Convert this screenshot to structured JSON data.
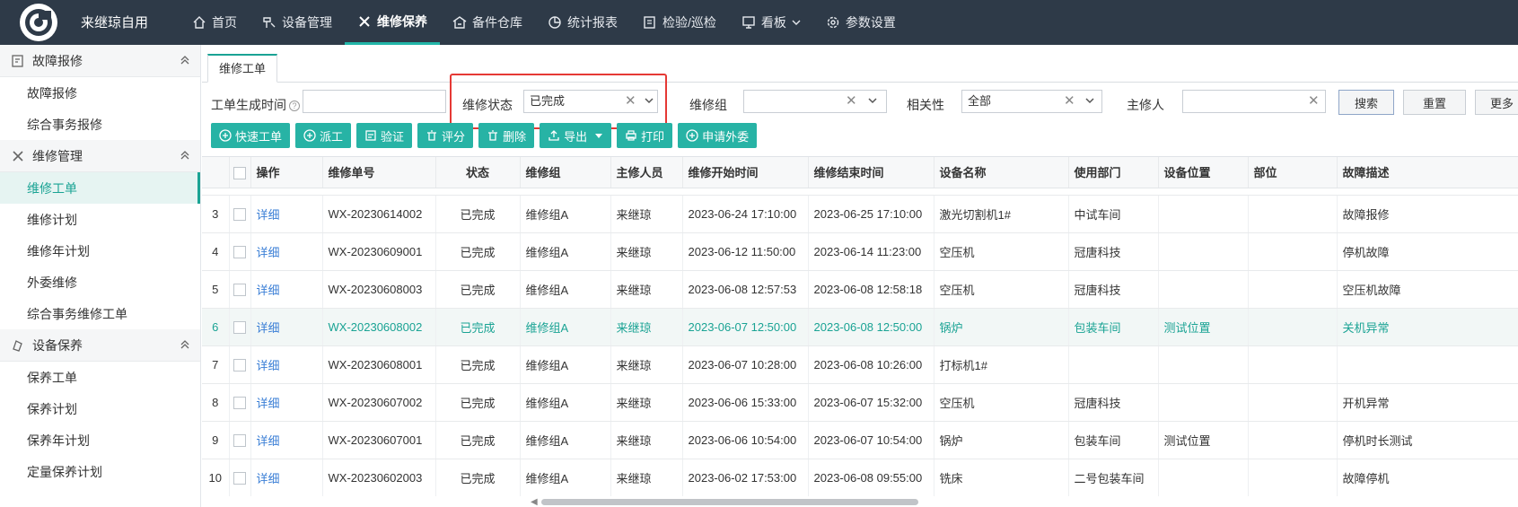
{
  "app": {
    "title": "来继琼自用"
  },
  "nav": [
    {
      "label": "首页",
      "icon": "home-icon"
    },
    {
      "label": "设备管理",
      "icon": "tools-icon"
    },
    {
      "label": "维修保养",
      "icon": "wrench-icon",
      "active": true
    },
    {
      "label": "备件仓库",
      "icon": "warehouse-icon"
    },
    {
      "label": "统计报表",
      "icon": "pie-chart-icon"
    },
    {
      "label": "检验/巡检",
      "icon": "clipboard-icon"
    },
    {
      "label": "看板",
      "icon": "monitor-icon",
      "dropdown": true
    },
    {
      "label": "参数设置",
      "icon": "gear-icon"
    }
  ],
  "sidebar": {
    "groups": [
      {
        "label": "故障报修",
        "items": [
          "故障报修",
          "综合事务报修"
        ]
      },
      {
        "label": "维修管理",
        "items": [
          "维修工单",
          "维修计划",
          "维修年计划",
          "外委维修",
          "综合事务维修工单"
        ]
      },
      {
        "label": "设备保养",
        "items": [
          "保养工单",
          "保养计划",
          "保养年计划",
          "定量保养计划"
        ]
      }
    ],
    "active_item": "维修工单"
  },
  "tab": {
    "label": "维修工单"
  },
  "filters": {
    "created_time_label": "工单生成时间",
    "created_time_value": "",
    "status_label": "维修状态",
    "status_value": "已完成",
    "group_label": "维修组",
    "group_value": "",
    "relevance_label": "相关性",
    "relevance_value": "全部",
    "lead_label": "主修人",
    "lead_value": "",
    "search_button": "搜索",
    "reset_button": "重置",
    "more_button": "更多"
  },
  "toolbar": {
    "quick_order": "快速工单",
    "dispatch": "派工",
    "verify": "验证",
    "rate": "评分",
    "delete": "删除",
    "export": "导出",
    "print": "打印",
    "outsource": "申请外委"
  },
  "table": {
    "headers": [
      "操作",
      "维修单号",
      "状态",
      "维修组",
      "主修人员",
      "维修开始时间",
      "维修结束时间",
      "设备名称",
      "使用部门",
      "设备位置",
      "部位",
      "故障描述"
    ],
    "rows": [
      {
        "no": "3",
        "action": "详细",
        "order": "WX-20230614002",
        "status": "已完成",
        "group": "维修组A",
        "lead": "来继琼",
        "start": "2023-06-24 17:10:00",
        "end": "2023-06-25 17:10:00",
        "device": "激光切割机1#",
        "dept": "中试车间",
        "location": "",
        "part": "",
        "desc": "故障报修"
      },
      {
        "no": "4",
        "action": "详细",
        "order": "WX-20230609001",
        "status": "已完成",
        "group": "维修组A",
        "lead": "来继琼",
        "start": "2023-06-12 11:50:00",
        "end": "2023-06-14 11:23:00",
        "device": "空压机",
        "dept": "冠唐科技",
        "location": "",
        "part": "",
        "desc": "停机故障"
      },
      {
        "no": "5",
        "action": "详细",
        "order": "WX-20230608003",
        "status": "已完成",
        "group": "维修组A",
        "lead": "来继琼",
        "start": "2023-06-08 12:57:53",
        "end": "2023-06-08 12:58:18",
        "device": "空压机",
        "dept": "冠唐科技",
        "location": "",
        "part": "",
        "desc": "空压机故障"
      },
      {
        "no": "6",
        "action": "详细",
        "order": "WX-20230608002",
        "status": "已完成",
        "group": "维修组A",
        "lead": "来继琼",
        "start": "2023-06-07 12:50:00",
        "end": "2023-06-08 12:50:00",
        "device": "锅炉",
        "dept": "包装车间",
        "location": "测试位置",
        "part": "",
        "desc": "关机异常",
        "highlight": true
      },
      {
        "no": "7",
        "action": "详细",
        "order": "WX-20230608001",
        "status": "已完成",
        "group": "维修组A",
        "lead": "来继琼",
        "start": "2023-06-07 10:28:00",
        "end": "2023-06-08 10:26:00",
        "device": "打标机1#",
        "dept": "",
        "location": "",
        "part": "",
        "desc": ""
      },
      {
        "no": "8",
        "action": "详细",
        "order": "WX-20230607002",
        "status": "已完成",
        "group": "维修组A",
        "lead": "来继琼",
        "start": "2023-06-06 15:33:00",
        "end": "2023-06-07 15:32:00",
        "device": "空压机",
        "dept": "冠唐科技",
        "location": "",
        "part": "",
        "desc": "开机异常"
      },
      {
        "no": "9",
        "action": "详细",
        "order": "WX-20230607001",
        "status": "已完成",
        "group": "维修组A",
        "lead": "来继琼",
        "start": "2023-06-06 10:54:00",
        "end": "2023-06-07 10:54:00",
        "device": "锅炉",
        "dept": "包装车间",
        "location": "测试位置",
        "part": "",
        "desc": "停机时长测试"
      },
      {
        "no": "10",
        "action": "详细",
        "order": "WX-20230602003",
        "status": "已完成",
        "group": "维修组A",
        "lead": "来继琼",
        "start": "2023-06-02 17:53:00",
        "end": "2023-06-08 09:55:00",
        "device": "铣床",
        "dept": "二号包装车间",
        "location": "",
        "part": "",
        "desc": "故障停机"
      }
    ]
  },
  "colors": {
    "accent": "#27b3a5",
    "topbar": "#2e3a48",
    "link": "#3b7fd6",
    "highlight_border": "#e53935"
  }
}
